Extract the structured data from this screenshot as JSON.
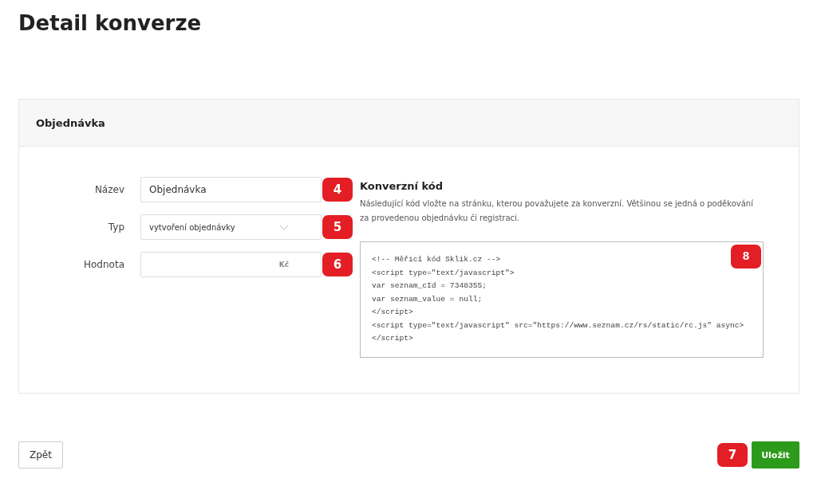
{
  "page_title": "Detail konverze",
  "card": {
    "title": "Objednávka"
  },
  "fields": [
    {
      "label": "Název",
      "kind": "text",
      "value": "Objednávka",
      "badge": "4"
    },
    {
      "label": "Typ",
      "kind": "select",
      "value": "vytvoření objednávky",
      "badge": "5"
    },
    {
      "label": "Hodnota",
      "kind": "currency",
      "suffix": "Kč",
      "badge": "6"
    }
  ],
  "code_section": {
    "title": "Konverzní kód",
    "description": "Následující kód vložte na stránku, kterou považujete za konverzní. Většinou se jedná o poděkování za provedenou objednávku či registraci.",
    "badge": "8",
    "lines": [
      "<!-- Měřicí kód Sklik.cz -->",
      "<script type=\"text/javascript\">",
      "var seznam_cId = 7348355;",
      "var seznam_value = null;",
      "</script>",
      "<script type=\"text/javascript\" src=\"https://www.seznam.cz/rs/static/rc.js\" async>",
      "</script>"
    ]
  },
  "buttons": {
    "back": "Zpět",
    "save": "Uložit",
    "save_badge": "7"
  }
}
